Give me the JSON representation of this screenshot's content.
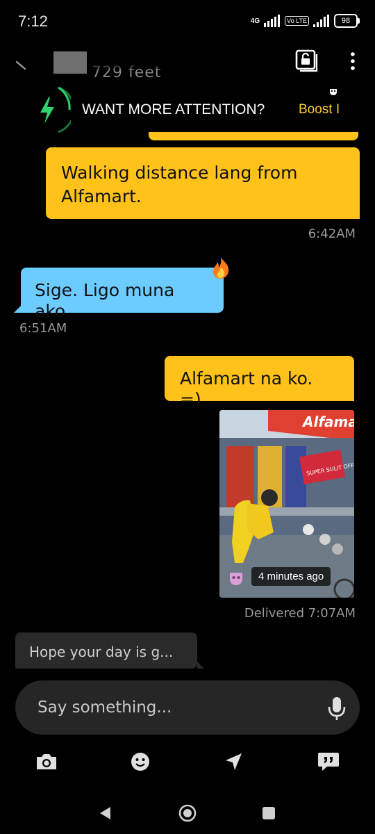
{
  "status_bar": {
    "time": "7:12",
    "network": "4G",
    "volte": "Vo LTE",
    "battery": "98"
  },
  "header": {
    "subtitle": "729 feet"
  },
  "boost_banner": {
    "text": "WANT MORE ATTENTION?",
    "link": "Boost I"
  },
  "messages": [
    {
      "direction": "outgoing",
      "text": "Walking distance lang from Alfamart.",
      "time": "6:42AM"
    },
    {
      "direction": "incoming",
      "text": "Sige. Ligo muna ako",
      "time": "6:51AM",
      "reaction": "fire-icon"
    },
    {
      "direction": "outgoing",
      "text": "Alfamart na ko. =)"
    },
    {
      "direction": "outgoing",
      "type": "photo",
      "badge": "4 minutes ago",
      "sign_text": "Alfama",
      "poster_text": "SUPER SULIT OFFERS",
      "status": "Delivered 7:07AM"
    }
  ],
  "suggested_reply": "Hope your day is g...",
  "composer": {
    "placeholder": "Say something..."
  },
  "actions": [
    "camera-icon",
    "emoji-icon",
    "location-icon",
    "quick-replies-icon"
  ],
  "colors": {
    "outgoing_bubble": "#ffc21a",
    "incoming_bubble": "#6ccbff",
    "boost_accent": "#ffc93b",
    "bolt": "#2dd36f"
  }
}
